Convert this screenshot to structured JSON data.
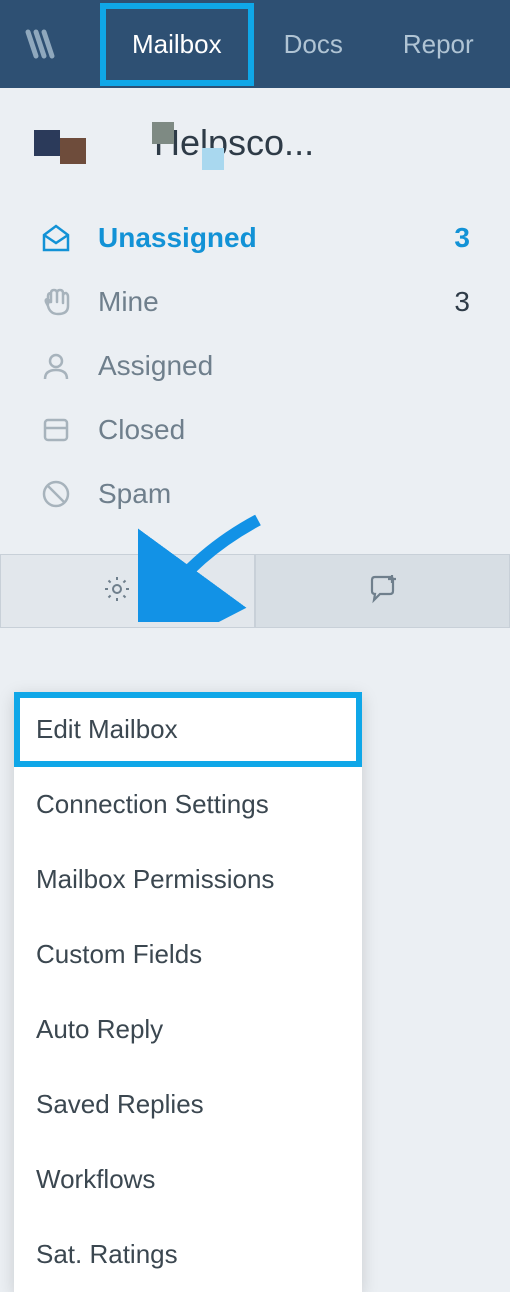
{
  "nav": {
    "items": [
      {
        "label": "Mailbox",
        "active": true
      },
      {
        "label": "Docs",
        "active": false
      },
      {
        "label": "Repor",
        "active": false
      }
    ]
  },
  "mailbox": {
    "title": "Helpsco..."
  },
  "folders": {
    "items": [
      {
        "label": "Unassigned",
        "count": "3",
        "active": true,
        "icon": "mail-open"
      },
      {
        "label": "Mine",
        "count": "3",
        "active": false,
        "icon": "hand"
      },
      {
        "label": "Assigned",
        "count": "",
        "active": false,
        "icon": "person"
      },
      {
        "label": "Closed",
        "count": "",
        "active": false,
        "icon": "archive"
      },
      {
        "label": "Spam",
        "count": "",
        "active": false,
        "icon": "block"
      }
    ]
  },
  "dropdown": {
    "items": [
      {
        "label": "Edit Mailbox",
        "highlighted": true
      },
      {
        "label": "Connection Settings",
        "highlighted": false
      },
      {
        "label": "Mailbox Permissions",
        "highlighted": false
      },
      {
        "label": "Custom Fields",
        "highlighted": false
      },
      {
        "label": "Auto Reply",
        "highlighted": false
      },
      {
        "label": "Saved Replies",
        "highlighted": false
      },
      {
        "label": "Workflows",
        "highlighted": false
      },
      {
        "label": "Sat. Ratings",
        "highlighted": false
      }
    ]
  }
}
